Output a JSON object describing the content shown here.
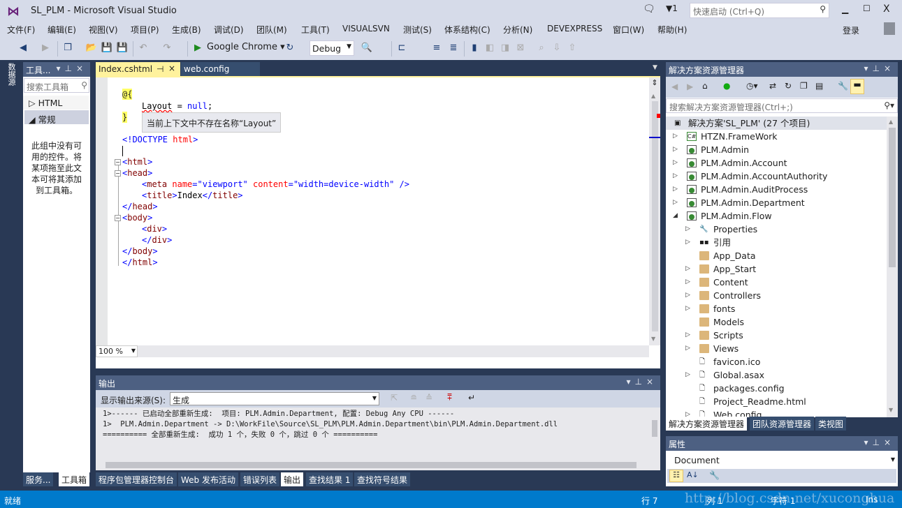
{
  "window": {
    "title": "SL_PLM - Microsoft Visual Studio",
    "quick_launch_placeholder": "快速启动 (Ctrl+Q)",
    "notification_count": "1",
    "sign_in": "登录"
  },
  "menu": [
    "文件(F)",
    "编辑(E)",
    "视图(V)",
    "项目(P)",
    "生成(B)",
    "调试(D)",
    "团队(M)",
    "工具(T)",
    "VISUALSVN",
    "测试(S)",
    "体系结构(C)",
    "分析(N)",
    "DEVEXPRESS",
    "窗口(W)",
    "帮助(H)"
  ],
  "toolbar": {
    "browser": "Google Chrome",
    "configuration": "Debug"
  },
  "left_strip": {
    "label": "数据源"
  },
  "toolbox": {
    "title": "工具...",
    "search_placeholder": "搜索工具箱",
    "groups": [
      {
        "label": "HTML",
        "expanded": false
      },
      {
        "label": "常规",
        "expanded": true
      }
    ],
    "empty_message": "此组中没有可用的控件。将某项拖至此文本可将其添加到工具箱。",
    "bottom_tabs": [
      {
        "label": "服务...",
        "selected": false
      },
      {
        "label": "工具箱",
        "selected": true
      }
    ]
  },
  "editor": {
    "tabs": [
      {
        "label": "Index.cshtml",
        "active": true
      },
      {
        "label": "web.config",
        "active": false
      }
    ],
    "tooltip": "当前上下文中不存在名称“Layout”",
    "zoom": "100 %",
    "code": {
      "l1": "@{",
      "l2a": "Layout",
      "l2b": " = ",
      "l2c": "null",
      ";": ";",
      "l3": "}",
      "doctype_a": "<!DOCTYPE ",
      "doctype_b": "html",
      "doctype_c": ">",
      "html_open": "html",
      "head_open": "head",
      "meta": "meta",
      "meta_name_attr": "name",
      "meta_name_val": "\"viewport\"",
      "meta_content_attr": "content",
      "meta_content_val": "\"width=device-width\"",
      "title": "title",
      "title_text": "Index",
      "div": "div",
      "body": "body",
      "head": "head",
      "html": "html"
    }
  },
  "output": {
    "title": "输出",
    "source_label": "显示输出来源(S):",
    "source_value": "生成",
    "lines": [
      "1>------ 已启动全部重新生成:  项目: PLM.Admin.Department, 配置: Debug Any CPU ------",
      "1>  PLM.Admin.Department -> D:\\WorkFile\\Source\\SL_PLM\\PLM.Admin.Department\\bin\\PLM.Admin.Department.dll",
      "========== 全部重新生成:  成功 1 个，失败 0 个，跳过 0 个 =========="
    ],
    "bottom_tabs": [
      {
        "label": "程序包管理器控制台",
        "selected": false
      },
      {
        "label": "Web 发布活动",
        "selected": false
      },
      {
        "label": "错误列表",
        "selected": false
      },
      {
        "label": "输出",
        "selected": true
      },
      {
        "label": "查找结果 1",
        "selected": false
      },
      {
        "label": "查找符号结果",
        "selected": false
      }
    ]
  },
  "solution_explorer": {
    "title": "解决方案资源管理器",
    "search_placeholder": "搜索解决方案资源管理器(Ctrl+;)",
    "items": [
      {
        "label": "解决方案'SL_PLM' (27 个项目)",
        "level": 0,
        "icon": "solution-icon",
        "expander": "none",
        "selected": true
      },
      {
        "label": "HTZN.FrameWork",
        "level": 0,
        "icon": "csharp-project-icon",
        "expander": "collapsed"
      },
      {
        "label": "PLM.Admin",
        "level": 0,
        "icon": "web-project-icon",
        "expander": "collapsed"
      },
      {
        "label": "PLM.Admin.Account",
        "level": 0,
        "icon": "web-project-icon",
        "expander": "collapsed"
      },
      {
        "label": "PLM.Admin.AccountAuthority",
        "level": 0,
        "icon": "web-project-icon",
        "expander": "collapsed"
      },
      {
        "label": "PLM.Admin.AuditProcess",
        "level": 0,
        "icon": "web-project-icon",
        "expander": "collapsed"
      },
      {
        "label": "PLM.Admin.Department",
        "level": 0,
        "icon": "web-project-icon",
        "expander": "collapsed"
      },
      {
        "label": "PLM.Admin.Flow",
        "level": 0,
        "icon": "web-project-icon",
        "expander": "expanded"
      },
      {
        "label": "Properties",
        "level": 1,
        "icon": "wrench-icon",
        "expander": "collapsed"
      },
      {
        "label": "引用",
        "level": 1,
        "icon": "references-icon",
        "expander": "collapsed"
      },
      {
        "label": "App_Data",
        "level": 1,
        "icon": "folder-icon",
        "expander": "none"
      },
      {
        "label": "App_Start",
        "level": 1,
        "icon": "folder-icon",
        "expander": "collapsed"
      },
      {
        "label": "Content",
        "level": 1,
        "icon": "folder-icon",
        "expander": "collapsed"
      },
      {
        "label": "Controllers",
        "level": 1,
        "icon": "folder-icon",
        "expander": "collapsed"
      },
      {
        "label": "fonts",
        "level": 1,
        "icon": "folder-icon",
        "expander": "collapsed"
      },
      {
        "label": "Models",
        "level": 1,
        "icon": "folder-icon",
        "expander": "none"
      },
      {
        "label": "Scripts",
        "level": 1,
        "icon": "folder-icon",
        "expander": "collapsed"
      },
      {
        "label": "Views",
        "level": 1,
        "icon": "folder-icon",
        "expander": "collapsed"
      },
      {
        "label": "favicon.ico",
        "level": 1,
        "icon": "file-icon",
        "expander": "none"
      },
      {
        "label": "Global.asax",
        "level": 1,
        "icon": "file-icon",
        "expander": "collapsed"
      },
      {
        "label": "packages.config",
        "level": 1,
        "icon": "file-icon",
        "expander": "none"
      },
      {
        "label": "Project_Readme.html",
        "level": 1,
        "icon": "file-icon",
        "expander": "none"
      },
      {
        "label": "Web.config",
        "level": 1,
        "icon": "file-icon",
        "expander": "collapsed"
      }
    ],
    "bottom_tabs": [
      {
        "label": "解决方案资源管理器",
        "selected": true
      },
      {
        "label": "团队资源管理器",
        "selected": false
      },
      {
        "label": "类视图",
        "selected": false
      }
    ]
  },
  "properties": {
    "title": "属性",
    "object": "Document"
  },
  "statusbar": {
    "status": "就绪",
    "line": "行 7",
    "col": "列 1",
    "char": "字符 1",
    "mode": "Ins",
    "watermark": "http://blog.csdn.net/xuconghua"
  },
  "colors": {
    "accent": "#007acc",
    "frame": "#293955",
    "panel_header": "#4d6082",
    "active_tab": "#fff29d"
  }
}
